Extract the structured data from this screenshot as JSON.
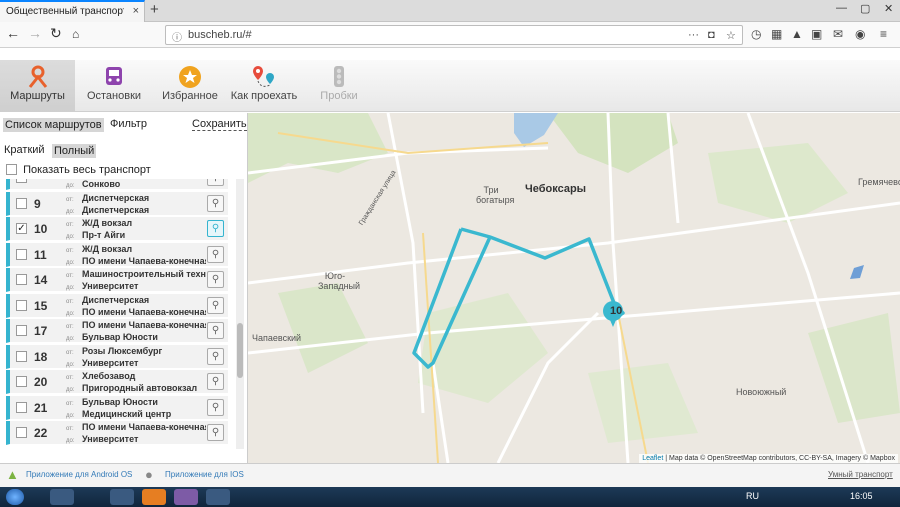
{
  "browser": {
    "tab_title": "Общественный транспорт города",
    "tab_close": "×",
    "new_tab": "+",
    "url": "buscheb.ru/#",
    "win_min": "—",
    "win_max": "▢",
    "win_close": "✕"
  },
  "toolbar": {
    "items": [
      {
        "label": "Маршруты"
      },
      {
        "label": "Остановки"
      },
      {
        "label": "Избранное"
      },
      {
        "label": "Как проехать"
      },
      {
        "label": "Пробки"
      }
    ]
  },
  "panel": {
    "tab_list": "Список маршрутов",
    "tab_filter": "Фильтр",
    "save": "Сохранить",
    "mode_short": "Краткий",
    "mode_full": "Полный",
    "show_all": "Показать весь транспорт",
    "from_prefix": "от:",
    "to_prefix": "до:",
    "routes": [
      {
        "num": "",
        "from": "",
        "to": "Сонково",
        "checked": false
      },
      {
        "num": "9",
        "from": "Диспетчерская",
        "to": "Диспетчерская",
        "checked": false
      },
      {
        "num": "10",
        "from": "Ж/Д вокзал",
        "to": "Пр-т Айги",
        "checked": true
      },
      {
        "num": "11",
        "from": "Ж/Д вокзал",
        "to": "ПО имени Чапаева-конечная",
        "checked": false
      },
      {
        "num": "14",
        "from": "Машиностроительный техни",
        "to": "Университет",
        "checked": false
      },
      {
        "num": "15",
        "from": "Диспетчерская",
        "to": "ПО имени Чапаева-конечная",
        "checked": false
      },
      {
        "num": "17",
        "from": "ПО имени Чапаева-конечная",
        "to": "Бульвар Юности",
        "checked": false
      },
      {
        "num": "18",
        "from": "Розы Люксембург",
        "to": "Университет",
        "checked": false
      },
      {
        "num": "20",
        "from": "Хлебозавод",
        "to": "Пригородный автовокзал",
        "checked": false
      },
      {
        "num": "21",
        "from": "Бульвар Юности",
        "to": "Медицинский центр",
        "checked": false
      },
      {
        "num": "22",
        "from": "ПО имени Чапаева-конечная",
        "to": "Университет",
        "checked": false
      }
    ]
  },
  "map": {
    "city": "Чебоксары",
    "labels": [
      "Три богатыря",
      "Юго-Западный",
      "Чапаевский",
      "Новоюжный",
      "Гремячево",
      "Гражданская улица"
    ],
    "marker": "10",
    "attribution_leaflet": "Leaflet",
    "attribution_text": "| Map data © OpenStreetMap contributors, CC-BY-SA, Imagery © Mapbox",
    "route_color": "#3ab8cf"
  },
  "footer": {
    "android": "Приложение для Android OS",
    "ios": "Приложение для IOS",
    "brand": "Умный транспорт"
  },
  "taskbar": {
    "lang": "RU",
    "time": "16:05"
  }
}
